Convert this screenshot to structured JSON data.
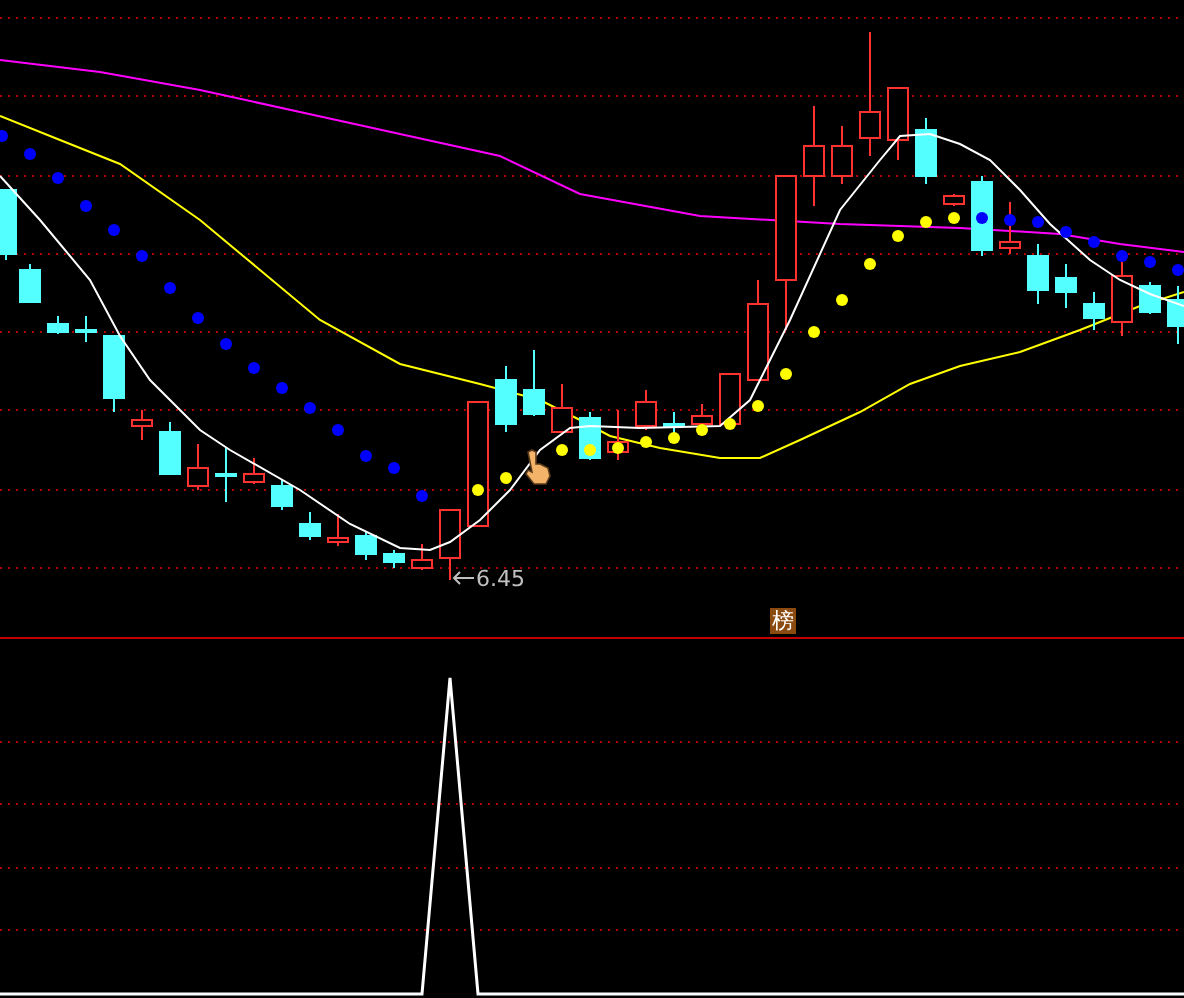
{
  "price_chart": {
    "low_label": "6.45"
  },
  "badge": {
    "label": "榜"
  }
}
